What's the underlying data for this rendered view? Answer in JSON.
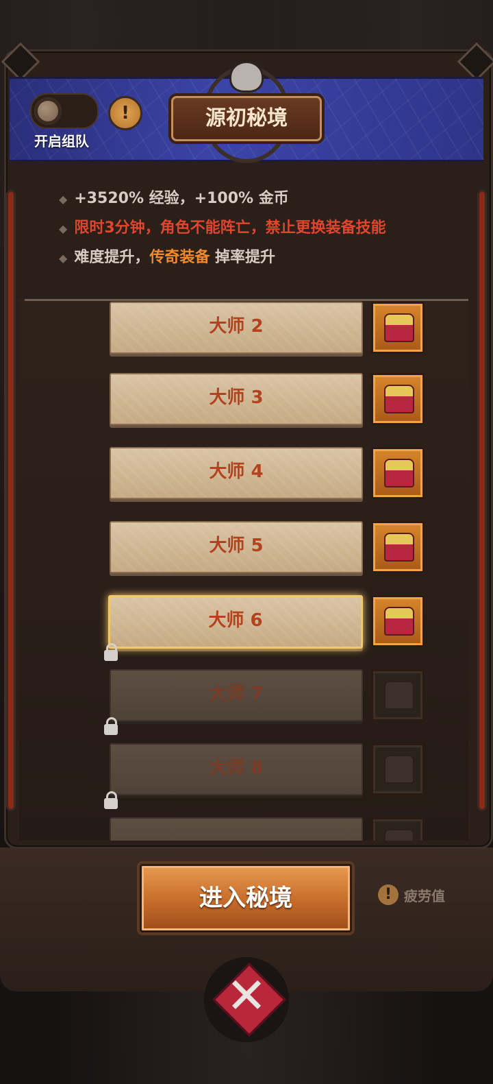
{
  "header": {
    "team_toggle_label": "开启组队",
    "info_icon": "!",
    "title": "源初秘境"
  },
  "description": {
    "line1": "+3520% 经验，+100% 金币",
    "line2": "限时3分钟，角色不能阵亡，禁止更换装备技能",
    "line3_prefix": "难度提升，",
    "line3_highlight": "传奇装备",
    "line3_suffix": " 掉率提升"
  },
  "levels": [
    {
      "label": "大师 2",
      "locked": false
    },
    {
      "label": "大师 3",
      "locked": false
    },
    {
      "label": "大师 4",
      "locked": false
    },
    {
      "label": "大师 5",
      "locked": false
    },
    {
      "label": "大师 6",
      "locked": false,
      "selected": true
    },
    {
      "label": "大师 7",
      "locked": true
    },
    {
      "label": "大师 8",
      "locked": true
    },
    {
      "label": "",
      "locked": true
    }
  ],
  "footer": {
    "enter_button": "进入秘境",
    "fatigue_icon": "!",
    "fatigue_label": "疲劳值",
    "close_icon": "✕"
  },
  "colors": {
    "desc_normal": "#d7cdc4",
    "desc_warning": "#e0452e",
    "desc_highlight": "#f08a2c",
    "level_text": "#b3431e"
  }
}
